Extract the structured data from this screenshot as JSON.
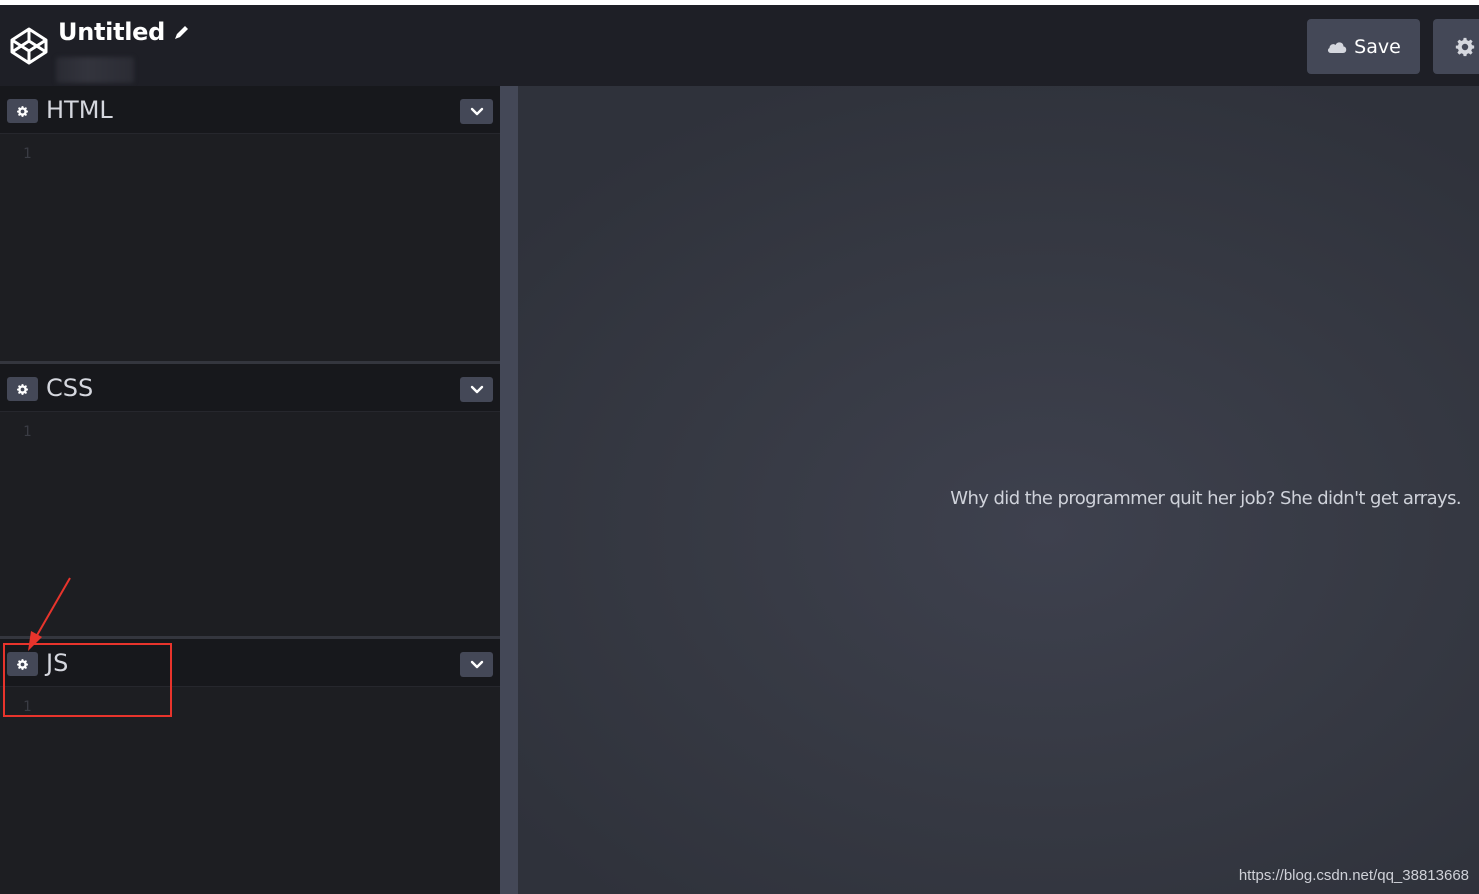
{
  "header": {
    "title": "Untitled",
    "logo_icon": "codepen-cube-icon",
    "edit_icon": "pencil-icon",
    "save_label": "Save",
    "save_icon": "cloud-icon",
    "settings_icon": "gear-icon"
  },
  "editors": [
    {
      "title": "HTML",
      "line_number": "1",
      "settings_icon": "gear-icon",
      "toggle_icon": "chevron-down-icon"
    },
    {
      "title": "CSS",
      "line_number": "1",
      "settings_icon": "gear-icon",
      "toggle_icon": "chevron-down-icon"
    },
    {
      "title": "JS",
      "line_number": "1",
      "settings_icon": "gear-icon",
      "toggle_icon": "chevron-down-icon"
    }
  ],
  "preview": {
    "text": "Why did the programmer quit her job? She didn't get arrays."
  },
  "watermark": "https://blog.csdn.net/qq_38813668",
  "annotation": {
    "color": "#e8342c",
    "target": "JS"
  },
  "colors": {
    "header_bg": "#1e1f26",
    "editor_bg": "#1d1e22",
    "button_bg": "#444857",
    "preview_bg": "#363943"
  }
}
